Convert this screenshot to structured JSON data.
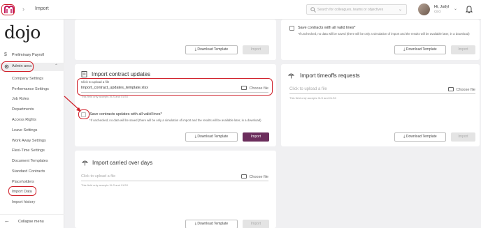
{
  "header": {
    "breadcrumb": "Import",
    "search_placeholder": "Search for colleagues, teams or objectives",
    "user_name": "Hi, Judyl",
    "user_role": "CEO"
  },
  "sidebar": {
    "brand": "dojo",
    "items": [
      {
        "label": "Preliminary Payroll"
      },
      {
        "label": "Admin area"
      }
    ],
    "sub_items": [
      "Company Settings",
      "Performance Settings",
      "Job Roles",
      "Departments",
      "Access Rights",
      "Leave Settings",
      "Work Away Settings",
      "Flexi-Time Settings",
      "Document Templates",
      "Standard Contracts",
      "Placeholders",
      "Import Data",
      "Import history"
    ],
    "collapse_label": "Collapse menu"
  },
  "top_left_card": {
    "download_label": "Download Template",
    "import_label": "Import"
  },
  "top_right_card": {
    "checkbox_label": "Save contracts with all valid lines*",
    "checkbox_desc": "*If unchecked, no data will be saved (there will be only a simulation of import and the results will be available later, in a download)",
    "download_label": "Download Template",
    "import_label": "Import"
  },
  "contract_updates": {
    "title": "Import contract updates",
    "file_label": "Click to upload a file",
    "file_name": "Import_contract_updates_template.xlsx",
    "choose_label": "Choose file",
    "hint": "This field only accepts XLS and XLSX",
    "checkbox_label": "Save contracts updates with all valid lines*",
    "checkbox_desc": "*If unchecked, no data will be saved (there will be only a simulation of import and the results will be available later, in a download)",
    "download_label": "Download Template",
    "import_label": "Import"
  },
  "timeoffs": {
    "title": "Import timeoffs requests",
    "file_placeholder": "Click to upload a file",
    "choose_label": "Choose file",
    "hint": "This field only accepts XLS and XLSX",
    "download_label": "Download Template",
    "import_label": "Import"
  },
  "carried_over": {
    "title": "Import carried over days",
    "file_placeholder": "Click to upload a file",
    "choose_label": "Choose file",
    "hint": "This field only accepts XLS and XLSX",
    "download_label": "Download Template",
    "import_label": "Import"
  },
  "colors": {
    "brand": "#c2185b",
    "primary_button": "#6b2d5c",
    "annotation": "#d0202a"
  },
  "icons": [
    "dojo-logo-icon",
    "search-icon",
    "chevron-down-icon",
    "bell-icon",
    "dollar-icon",
    "gear-icon",
    "chevron-up-icon",
    "arrow-left-icon",
    "folder-icon",
    "document-icon",
    "beach-umbrella-icon",
    "download-icon"
  ]
}
